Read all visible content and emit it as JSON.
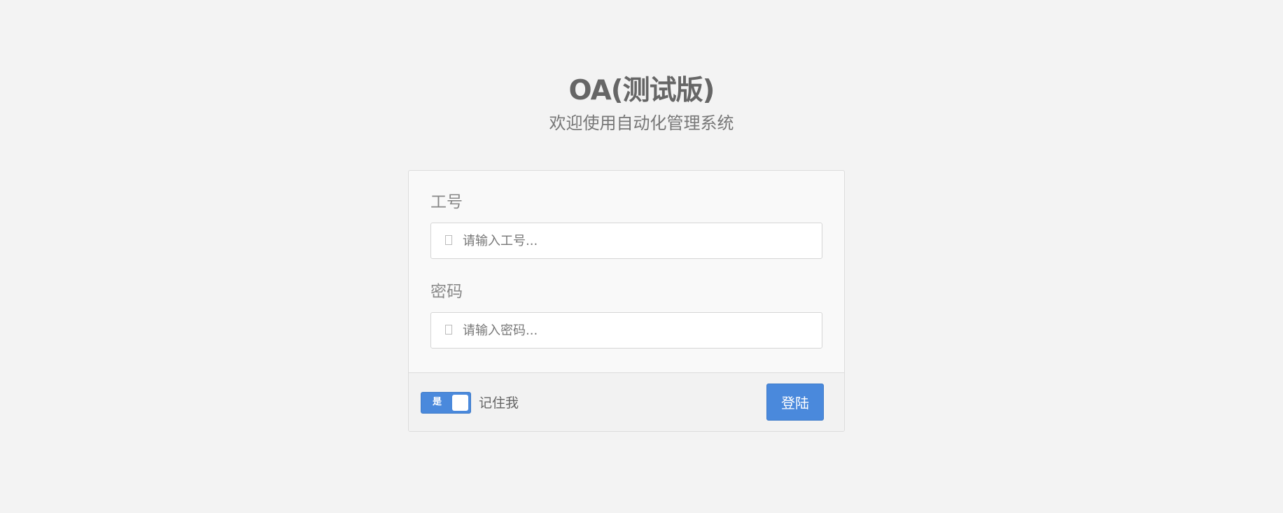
{
  "header": {
    "title": "OA(测试版)",
    "subtitle": "欢迎使用自动化管理系统"
  },
  "form": {
    "employee_id": {
      "label": "工号",
      "placeholder": "请输入工号...",
      "value": "",
      "icon": "user-icon"
    },
    "password": {
      "label": "密码",
      "placeholder": "请输入密码...",
      "value": "",
      "icon": "lock-icon"
    }
  },
  "footer": {
    "remember_toggle_text": "是",
    "remember_toggle_on": true,
    "remember_label": "记住我",
    "login_label": "登陆"
  },
  "colors": {
    "accent": "#4a89dc",
    "background": "#f3f3f3"
  }
}
